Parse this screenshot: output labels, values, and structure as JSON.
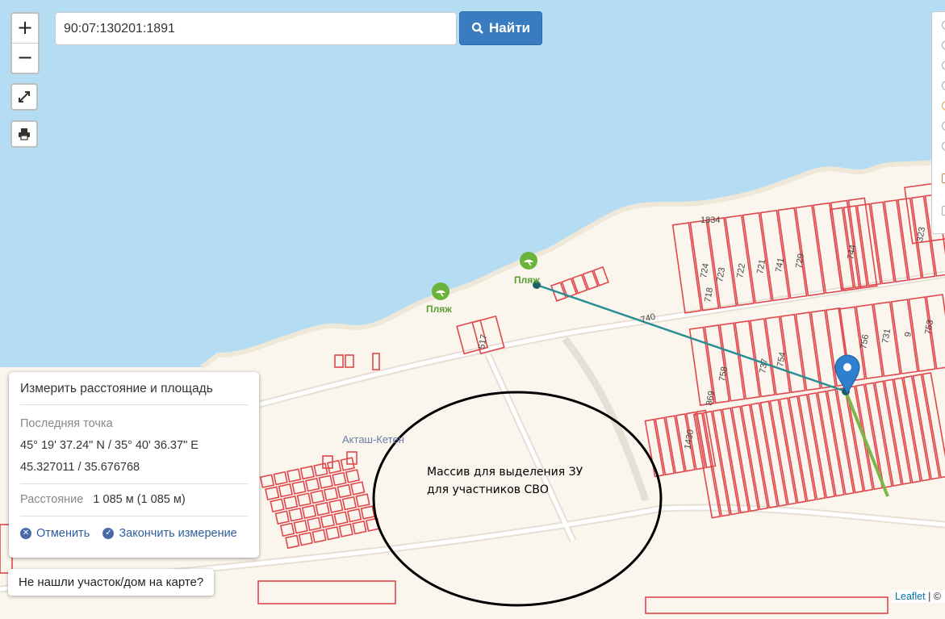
{
  "search": {
    "value": "90:07:130201:1891",
    "button_label": "Найти"
  },
  "zoom": {
    "in_label": "+",
    "out_label": "−"
  },
  "icons": {
    "fullscreen": "expand-icon",
    "print": "printer-icon",
    "search": "search-icon",
    "beach": "beach-umbrella-icon",
    "marker": "map-pin-icon"
  },
  "map": {
    "place_label": "Акташ-Кетен",
    "beach_labels": [
      "Пляж",
      "Пляж"
    ],
    "parcel_labels": [
      "1834",
      "724",
      "723",
      "722",
      "721",
      "741",
      "729",
      "718",
      "744",
      "323",
      "740",
      "756",
      "731",
      "9",
      "753",
      "758",
      "737",
      "754",
      "869",
      "1430",
      "517"
    ],
    "annotation_line1": "Массив для выделения ЗУ",
    "annotation_line2": "для участников СВО",
    "colors": {
      "sea": "#b4dcf2",
      "land": "#faf6ee",
      "parcel": "#e0474c",
      "measure_line": "#2a8f94",
      "marker": "#2f7fcf"
    }
  },
  "measure_panel": {
    "title": "Измерить расстояние и площадь",
    "last_point_label": "Последняя точка",
    "coords_dms": "45° 19' 37.24\" N / 35° 40' 36.37\" E",
    "coords_decimal": "45.327011 / 35.676768",
    "distance_label": "Расстояние",
    "distance_value": "1 085 м (1 085 м)",
    "cancel_label": "Отменить",
    "finish_label": "Закончить измерение"
  },
  "not_found_button": "Не нашли участок/дом на карте?",
  "attribution": {
    "leaflet": "Leaflet",
    "sep": "| ©"
  }
}
